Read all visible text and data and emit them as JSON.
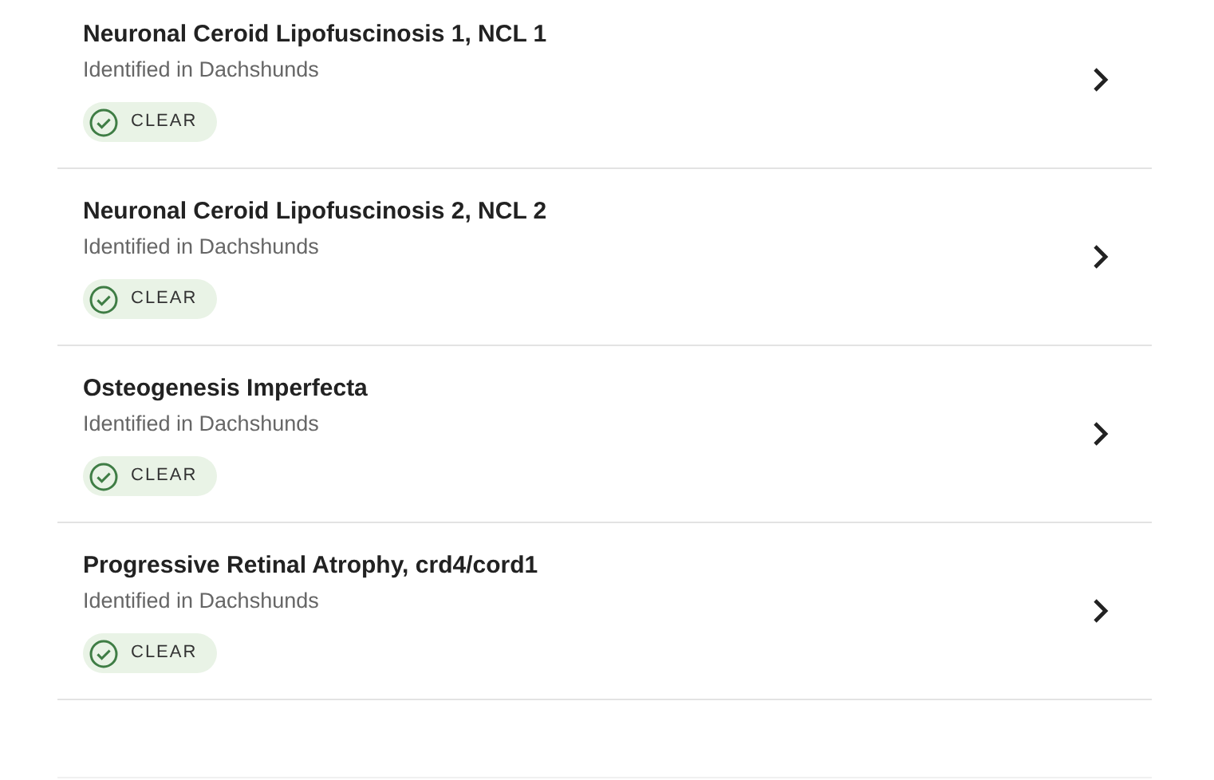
{
  "tests": [
    {
      "title": "Neuronal Ceroid Lipofuscinosis 1, NCL 1",
      "subtitle": "Identified in Dachshunds",
      "badge": "CLEAR"
    },
    {
      "title": "Neuronal Ceroid Lipofuscinosis 2, NCL 2",
      "subtitle": "Identified in Dachshunds",
      "badge": "CLEAR"
    },
    {
      "title": "Osteogenesis Imperfecta",
      "subtitle": "Identified in Dachshunds",
      "badge": "CLEAR"
    },
    {
      "title": "Progressive Retinal Atrophy, crd4/cord1",
      "subtitle": "Identified in Dachshunds",
      "badge": "CLEAR"
    }
  ]
}
